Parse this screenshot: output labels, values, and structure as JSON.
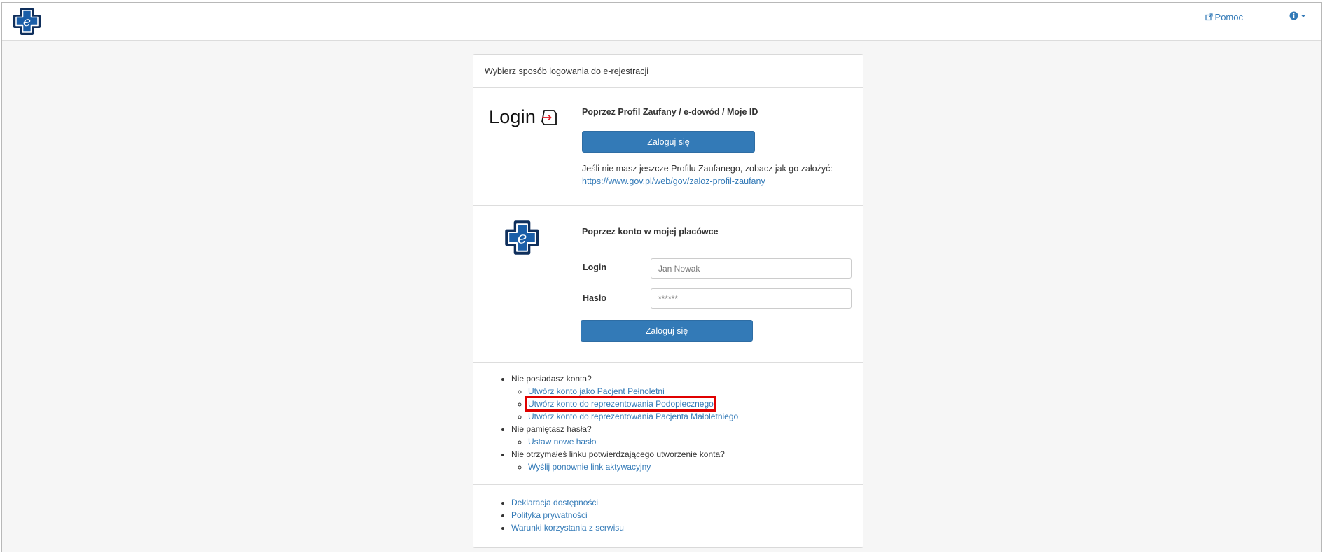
{
  "navbar": {
    "help_label": "Pomoc",
    "help_icon": "external-link-icon",
    "info_icon": "info-icon"
  },
  "panel": {
    "heading": "Wybierz sposób logowania do e-rejestracji"
  },
  "profil_zaufany": {
    "brand_word": "Login",
    "title": "Poprzez Profil Zaufany / e-dowód / Moje ID",
    "button_label": "Zaloguj się",
    "info_text": "Jeśli nie masz jeszcze Profilu Zaufanego, zobacz jak go założyć:",
    "info_link": "https://www.gov.pl/web/gov/zaloz-profil-zaufany"
  },
  "local_account": {
    "title": "Poprzez konto w mojej placówce",
    "login_label": "Login",
    "login_value": "Jan Nowak",
    "password_label": "Hasło",
    "password_value": "******",
    "button_label": "Zaloguj się"
  },
  "help_links": {
    "no_account": "Nie posiadasz konta?",
    "create_adult": "Utwórz konto jako Pacjent Pełnoletni",
    "create_ward": "Utwórz konto do reprezentowania Podopiecznego",
    "create_minor": "Utwórz konto do reprezentowania Pacjenta Małoletniego",
    "forgot_password": "Nie pamiętasz hasła?",
    "set_new_password": "Ustaw nowe hasło",
    "no_link": "Nie otrzymałeś linku potwierdzającego utworzenie konta?",
    "resend_link": "Wyślij ponownie link aktywacyjny"
  },
  "footer": {
    "accessibility": "Deklaracja dostępności",
    "privacy": "Polityka prywatności",
    "terms": "Warunki korzystania z serwisu"
  },
  "colors": {
    "primary": "#337ab7",
    "logo_blue": "#1a5ea8",
    "logo_dark": "#0f2f5c",
    "highlight": "#e00000"
  }
}
